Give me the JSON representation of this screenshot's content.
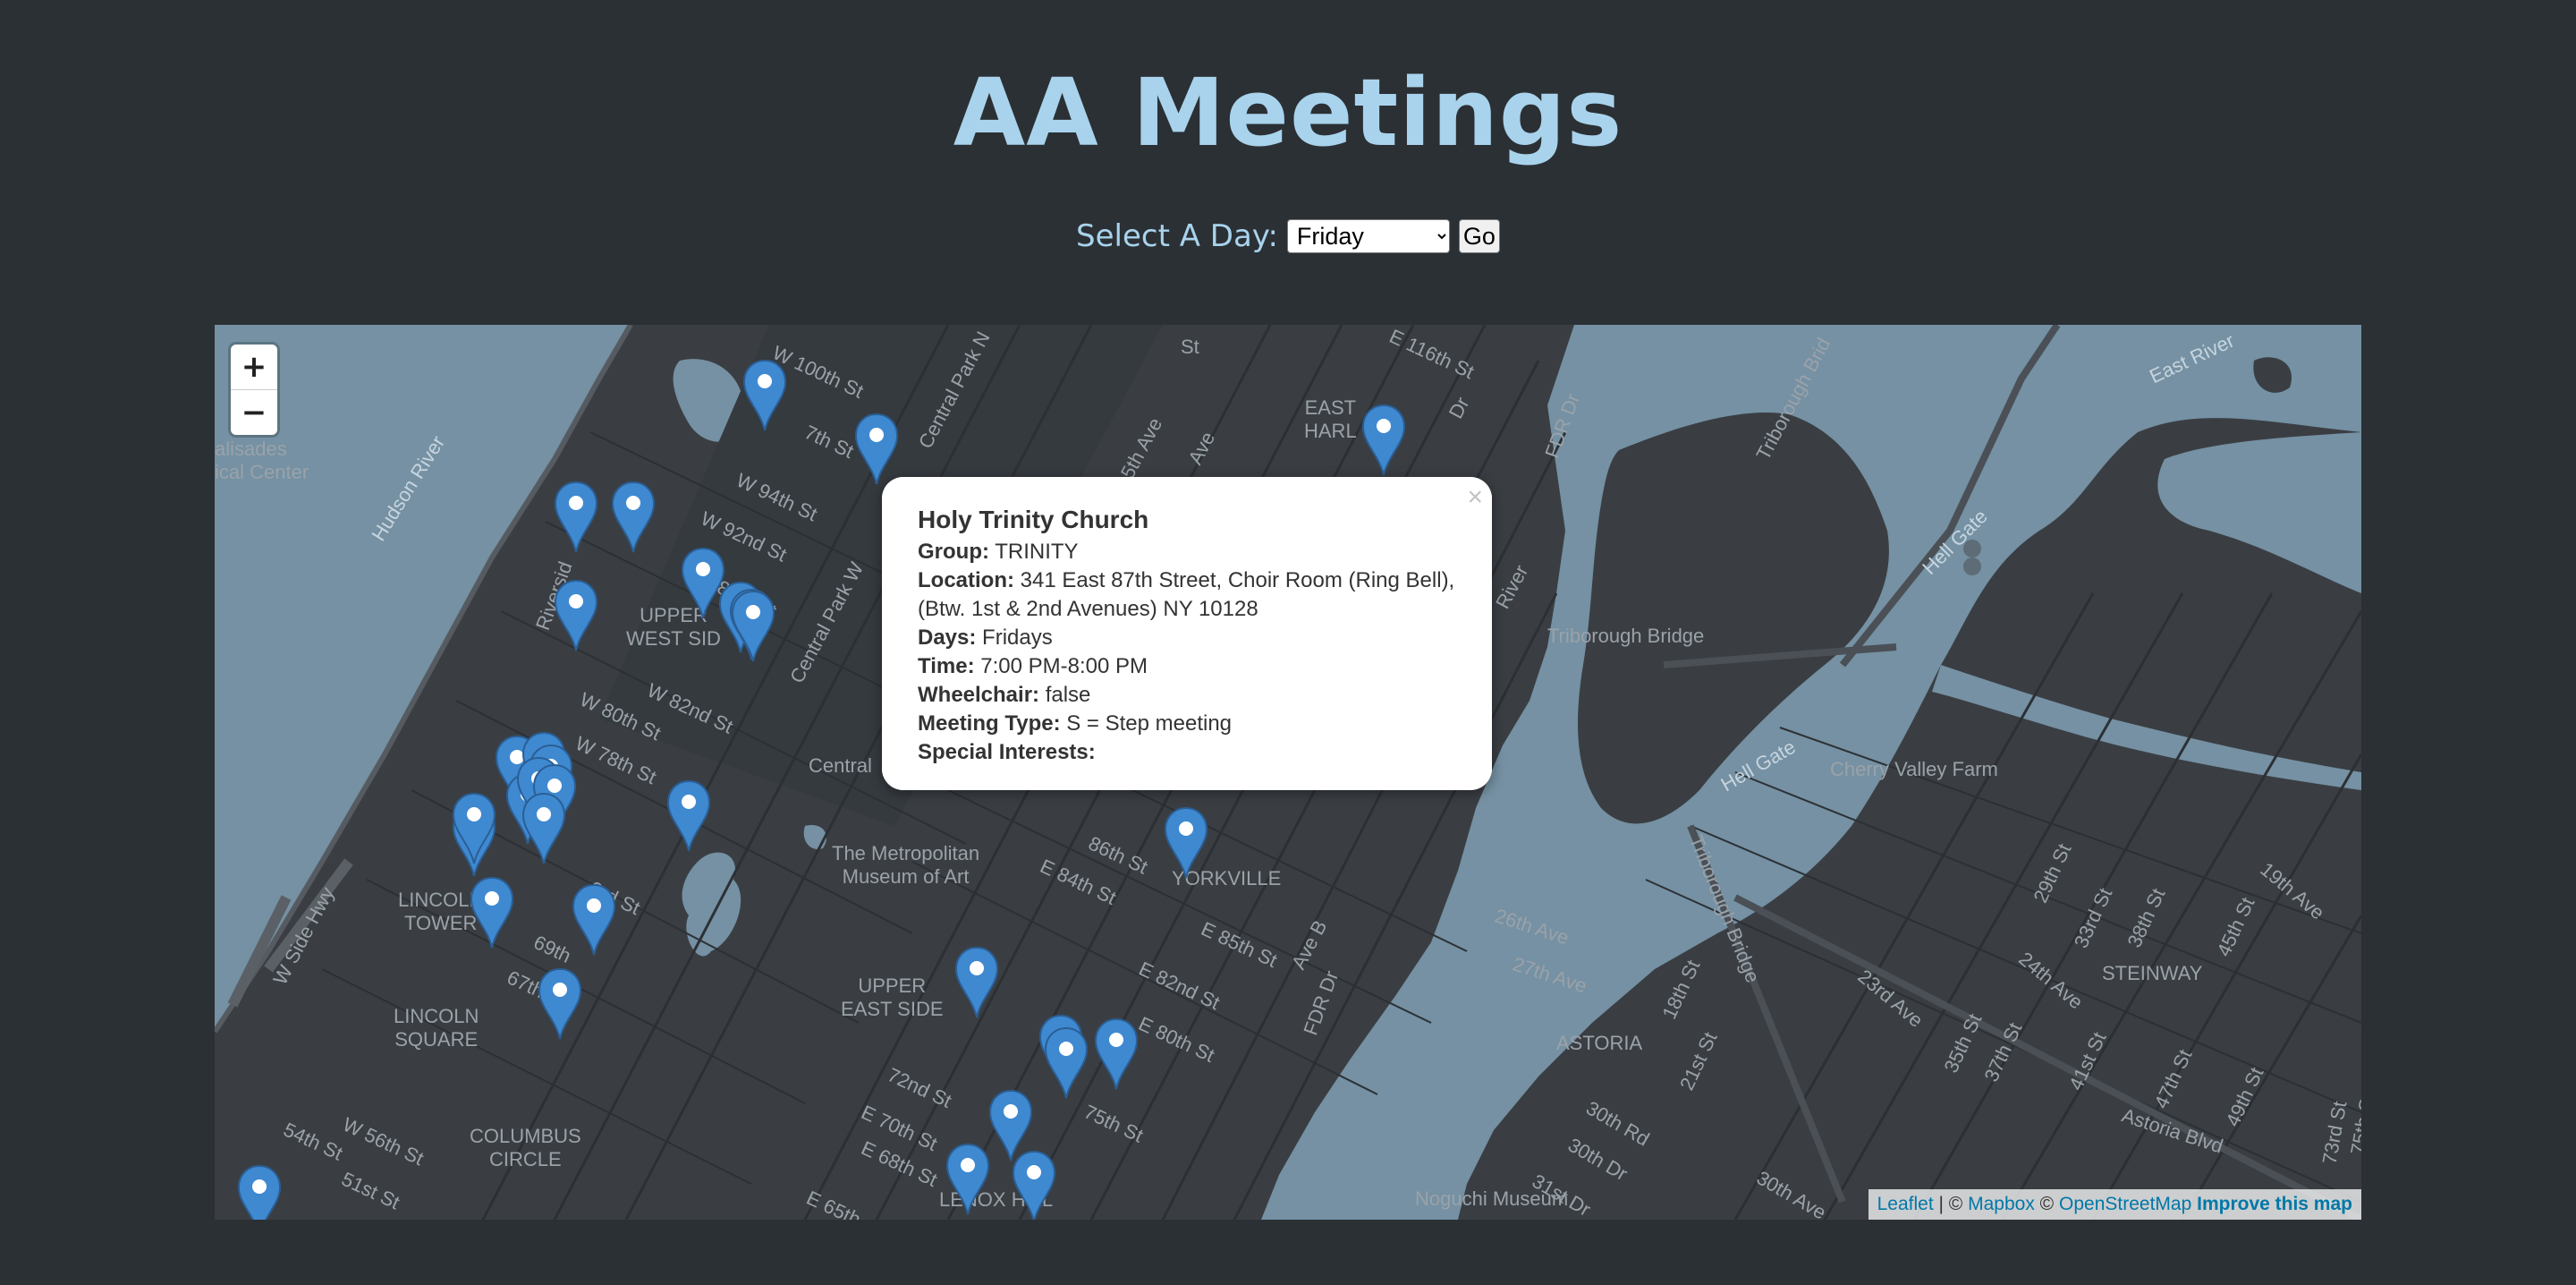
{
  "page": {
    "title": "AA Meetings"
  },
  "day_selector": {
    "label": "Select A Day:",
    "selected": "Friday",
    "go_label": "Go"
  },
  "map": {
    "zoom_in": "+",
    "zoom_out": "−",
    "water_color": "#7591a3",
    "land_color": "#3a3e43",
    "marker_color": "#3f89d1",
    "labels": {
      "hudson_river": "Hudson River",
      "east_river": "East River",
      "hell_gate_1": "Hell Gate",
      "hell_gate_2": "Hell Gate",
      "triborough_bridge": "Triborough Bridge",
      "triborough_brid": "Triborough Brid",
      "triborough_bridge_road": "Triborough Bridge",
      "cherry_valley_farm": "Cherry Valley Farm",
      "upper_west_side": "UPPER\nWEST SID",
      "upper_east_side": "UPPER\nEAST SIDE",
      "east_harlem": "EAST\nHARL",
      "yorkville": "YORKVILLE",
      "astoria": "ASTORIA",
      "steinway": "STEINWAY",
      "lincoln_towers": "LINCOLN\nTOWER",
      "lincoln_square": "LINCOLN\nSQUARE",
      "columbus_circle": "COLUMBUS\nCIRCLE",
      "lenox_hill": "LENOX HILL",
      "met_museum": "The Metropolitan\nMuseum of Art",
      "noguchi": "Noguchi Museum",
      "central": "Central",
      "palisades": "alisades\nical Center",
      "astoria_blvd": "Astoria Blvd",
      "fdr_dr": "FDR Dr",
      "fdr_dr_2": "FDR Dr",
      "w_100th": "W 100th St",
      "w_94th": "W 94th St",
      "w_92nd": "W 92nd St",
      "w_89th": "89th St",
      "w_82nd": "W 82nd St",
      "w_80th": "W 80th St",
      "w_78th": "W 78th St",
      "w_97th": "7th St",
      "riverside": "Riversid",
      "central_park_w": "Central Park W",
      "w_side_hwy": "W Side Hwy",
      "w_56th": "W 56th St",
      "w_54th": "54th St",
      "w_51st": "51st St",
      "e_116th": "E 116th St",
      "st_top": "St",
      "e_84th": "E 84th St",
      "e_82nd": "E 82nd St",
      "e_80th": "E 80th St",
      "e_85th": "E 85th St",
      "86th": "86th St",
      "72nd": "72nd St",
      "e_68th": "E 68th St",
      "e_70th": "E 70th St",
      "75th": "75th St",
      "e_65th": "E 65th",
      "26th_ave": "26th Ave",
      "27th_ave": "27th Ave",
      "23rd_ave": "23rd Ave",
      "24th_ave": "24th Ave",
      "30th_ave": "30th Ave",
      "30th_rd": "30th Rd",
      "30th_dr": "30th Dr",
      "31st_dr": "31st Dr",
      "18th_st": "18th St",
      "21st_st": "21st St",
      "29th_st": "29th St",
      "33rd_st": "33rd St",
      "35th_st": "35th St",
      "37th_st": "37th St",
      "38th_st": "38th St",
      "41st_st": "41st St",
      "45th_st": "45th St",
      "47th_st": "47th St",
      "49th_st": "49th St",
      "73rd_st": "73rd St",
      "75th_st": "75th St",
      "19th_ave": "19th Ave",
      "3rd_st": "3rd St",
      "69th": "69th",
      "67th_st": "67th St",
      "5th_ave": "5th Ave",
      "ave": "Ave",
      "ave_b": "Ave B",
      "central_park_n": "Central Park N",
      "dr": "Dr",
      "river": "River"
    }
  },
  "popup": {
    "title": "Holy Trinity Church",
    "close": "×",
    "group_label": "Group:",
    "group": "TRINITY",
    "location_label": "Location:",
    "location": "341 East 87th Street, Choir Room (Ring Bell), (Btw. 1st & 2nd Avenues) NY 10128",
    "days_label": "Days:",
    "days": "Fridays",
    "time_label": "Time:",
    "time": "7:00 PM-8:00 PM",
    "wheelchair_label": "Wheelchair:",
    "wheelchair": "false",
    "meeting_type_label": "Meeting Type:",
    "meeting_type": "S = Step meeting",
    "special_interests_label": "Special Interests:",
    "special_interests": ""
  },
  "attribution": {
    "leaflet": "Leaflet",
    "sep1": " | © ",
    "mapbox": "Mapbox",
    "sep2": " © ",
    "osm": "OpenStreetMap",
    "improve": "Improve this map"
  }
}
